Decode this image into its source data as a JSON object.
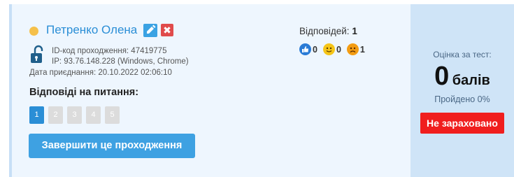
{
  "participant": {
    "name": "Петренко Олена",
    "status_dot_color": "#f5c04a",
    "delete_glyph": "✖",
    "id_line": "ID-код проходження: 47419775",
    "ip_line": "IP: 93.76.148.228 (Windows, Chrome)",
    "joined_line": "Дата приєднання: 20.10.2022 02:06:10"
  },
  "questions": {
    "label": "Відповіді на питання:",
    "pages": [
      "1",
      "2",
      "3",
      "4",
      "5"
    ],
    "active_page": "1"
  },
  "finish_button": "Завершити це проходження",
  "answers": {
    "label": "Відповідей:",
    "count": "1",
    "reactions": [
      {
        "icon": "thumbs-up-icon",
        "count": "0"
      },
      {
        "icon": "smile-icon",
        "count": "0"
      },
      {
        "icon": "sad-face-icon",
        "count": "1"
      }
    ]
  },
  "score": {
    "title": "Оцінка за тест:",
    "value": "0",
    "unit": "балів",
    "passed": "Пройдено 0%",
    "status_badge": "Не зараховано",
    "badge_color": "#f01e1e"
  }
}
